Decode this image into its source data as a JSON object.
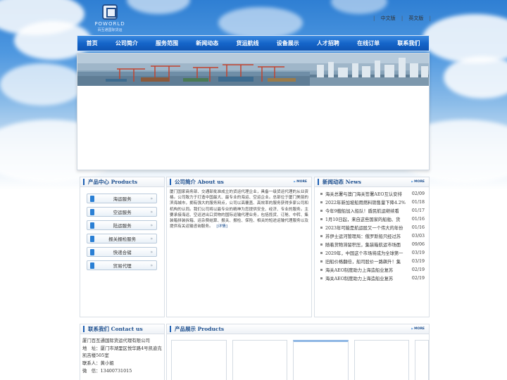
{
  "header": {
    "brand": "POWORLD",
    "brand_sub": "百互通国际货运",
    "lang_cn": "中文版",
    "lang_en": "英文版",
    "sep": "|"
  },
  "nav": {
    "items": [
      {
        "label": "首页"
      },
      {
        "label": "公司简介"
      },
      {
        "label": "服务范围"
      },
      {
        "label": "新闻动态"
      },
      {
        "label": "货运航线"
      },
      {
        "label": "设备展示"
      },
      {
        "label": "人才招聘"
      },
      {
        "label": "在线订单"
      },
      {
        "label": "联系我们"
      }
    ]
  },
  "product_center": {
    "title": "产品中心 Products",
    "items": [
      {
        "label": "海运服务"
      },
      {
        "label": "空运服务"
      },
      {
        "label": "陆运服务"
      },
      {
        "label": "报关报检服务"
      },
      {
        "label": "快递合储"
      },
      {
        "label": "贸易代理"
      }
    ]
  },
  "about": {
    "title": "公司简介 About us",
    "more": "MORE",
    "text": "厦门国家商务部、交通部批准成立的货运代理企业，具备一级货运代理的从业资格。公司致力于打造中国最大、最专业的海运、空运企业。总部位于厦门美丽的滨海城市，拥有强大的服务网点，公司以高覆盖、高效率的服务获得多家公司和机构的认同。我们公司将以最专业的精神为您提供安全、经济、专业的服务。主要承接海运、空运进出口货物的国际运输代理业务，包括揽货、订舱、中转、集装箱拼装拆箱、运杂费结算、报关、报检、保险、相关的短途运输代理服务以及提供有关运输咨询服务。",
    "link": "[详情]"
  },
  "news": {
    "title": "新闻动态 News",
    "more": "MORE",
    "items": [
      {
        "title": "海关总署与澳门海关签署AEO互认安排",
        "date": "02/09"
      },
      {
        "title": "2022年新加坡船用燃料销售量下降4.2%",
        "date": "01/18"
      },
      {
        "title": "今年9艘船加入船队！盾民航运继续看",
        "date": "01/17"
      },
      {
        "title": "1月10日起，来自这些国家的船舶、货",
        "date": "01/16"
      },
      {
        "title": "2023年可能是航运股又一个伟大的年份",
        "date": "01/16"
      },
      {
        "title": "苏伊士运河管理局：俄罗斯船只经过苏",
        "date": "03/03"
      },
      {
        "title": "随着货物滞留积压，集装箱航运市场面",
        "date": "09/06"
      },
      {
        "title": "2029年，中国这个市场将成为全球第一",
        "date": "03/19"
      },
      {
        "title": "旧船价格翻倍，船司股价一路飙升！集",
        "date": "03/19"
      },
      {
        "title": "海关AEO制度助力上海造船业复苏",
        "date": "02/19"
      },
      {
        "title": "海关AEO制度助力上海造船业复苏",
        "date": "02/19"
      }
    ]
  },
  "contact": {
    "title": "联系我们 Contact us",
    "company": "厦门百互通国际货运代理有限公司",
    "address_label": "地　址：",
    "address": "厦门市湖里区悦华路4号凯迪克凯吉楼505室",
    "person_label": "联系人：",
    "person": "黄小姐",
    "phone_label": "微　信：",
    "phone": "13400731015"
  },
  "product_show": {
    "title": "产品展示 Products",
    "more": "MORE"
  },
  "colors": {
    "nav_blue": "#1565c9",
    "title_blue": "#1d4f8f"
  }
}
